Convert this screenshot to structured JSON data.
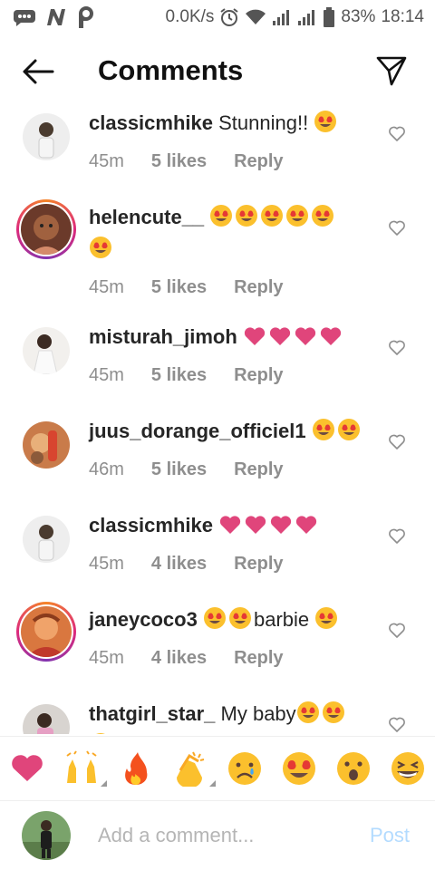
{
  "status_bar": {
    "network_speed": "0.0K/s",
    "battery": "83%",
    "time": "18:14"
  },
  "header": {
    "title": "Comments"
  },
  "comments": [
    {
      "username": "classicmhike",
      "text": "Stunning!!",
      "emojis": [
        "heart-eyes"
      ],
      "time": "45m",
      "likes": "5 likes",
      "reply": "Reply"
    },
    {
      "username": "helencute__",
      "text": "",
      "emojis": [
        "heart-eyes",
        "heart-eyes",
        "heart-eyes",
        "heart-eyes",
        "heart-eyes",
        "heart-eyes"
      ],
      "time": "45m",
      "likes": "5 likes",
      "reply": "Reply"
    },
    {
      "username": "misturah_jimoh",
      "text": "",
      "emojis": [
        "pink-heart",
        "pink-heart",
        "pink-heart",
        "pink-heart"
      ],
      "time": "45m",
      "likes": "5 likes",
      "reply": "Reply"
    },
    {
      "username": "juus_dorange_officiel1",
      "text": "",
      "emojis": [
        "heart-eyes",
        "heart-eyes"
      ],
      "time": "46m",
      "likes": "5 likes",
      "reply": "Reply"
    },
    {
      "username": "classicmhike",
      "text": "",
      "emojis": [
        "pink-heart",
        "pink-heart",
        "pink-heart",
        "pink-heart"
      ],
      "time": "45m",
      "likes": "4 likes",
      "reply": "Reply"
    },
    {
      "username": "janeycoco3",
      "text": "barbie",
      "emojis": [
        "heart-eyes",
        "heart-eyes",
        "heart-eyes"
      ],
      "time": "45m",
      "likes": "4 likes",
      "reply": "Reply"
    },
    {
      "username": "thatgirl_star_",
      "text": "My baby",
      "emojis": [
        "heart-eyes",
        "heart-eyes"
      ],
      "time": "",
      "likes": "",
      "reply": ""
    }
  ],
  "emoji_bar": [
    "heart",
    "raising-hands",
    "fire",
    "clapping-hands",
    "crying-face",
    "heart-eyes",
    "surprised-face",
    "grinning-squint-face"
  ],
  "composer": {
    "placeholder": "Add a comment...",
    "post_label": "Post"
  },
  "colors": {
    "link_blue_disabled": "#b3dbff",
    "meta_gray": "#8e8e8e",
    "heart_pink": "#e0457b"
  }
}
